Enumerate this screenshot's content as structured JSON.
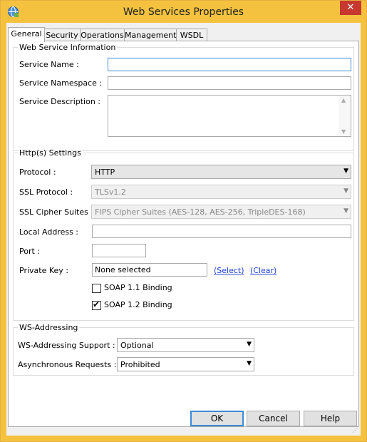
{
  "window": {
    "title": "Web Services Properties",
    "close_glyph": "✕",
    "icon": "app-icon"
  },
  "tabs": [
    "General",
    "Security",
    "Operations",
    "Management",
    "WSDL"
  ],
  "ws_info": {
    "legend": "Web Service Information",
    "service_name_label": "Service Name :",
    "service_name_value": "",
    "service_namespace_label": "Service Namespace :",
    "service_namespace_value": "",
    "service_description_label": "Service Description :",
    "service_description_value": ""
  },
  "http": {
    "legend": "Http(s) Settings",
    "protocol_label": "Protocol :",
    "protocol_value": "HTTP",
    "ssl_protocol_label": "SSL Protocol :",
    "ssl_protocol_value": "TLSv1.2",
    "ssl_cipher_label": "SSL Cipher Suites :",
    "ssl_cipher_value": "FIPS Cipher Suites (AES-128, AES-256, TripleDES-168)",
    "local_address_label": "Local Address :",
    "local_address_value": "",
    "port_label": "Port :",
    "port_value": "",
    "private_key_label": "Private Key :",
    "private_key_value": "None selected",
    "select_link": "(Select)",
    "clear_link": "(Clear)",
    "soap11_label": "SOAP 1.1 Binding",
    "soap11_checked": false,
    "soap12_label": "SOAP 1.2 Binding",
    "soap12_checked": true
  },
  "ws_addressing": {
    "legend": "WS-Addressing",
    "support_label": "WS-Addressing Support :",
    "support_value": "Optional",
    "async_label": "Asynchronous Requests :",
    "async_value": "Prohibited"
  },
  "buttons": {
    "ok": "OK",
    "cancel": "Cancel",
    "help": "Help"
  },
  "glyphs": {
    "dropdown": "▼",
    "check": "✔",
    "scroll_up": "▲",
    "scroll_down": "▼"
  }
}
